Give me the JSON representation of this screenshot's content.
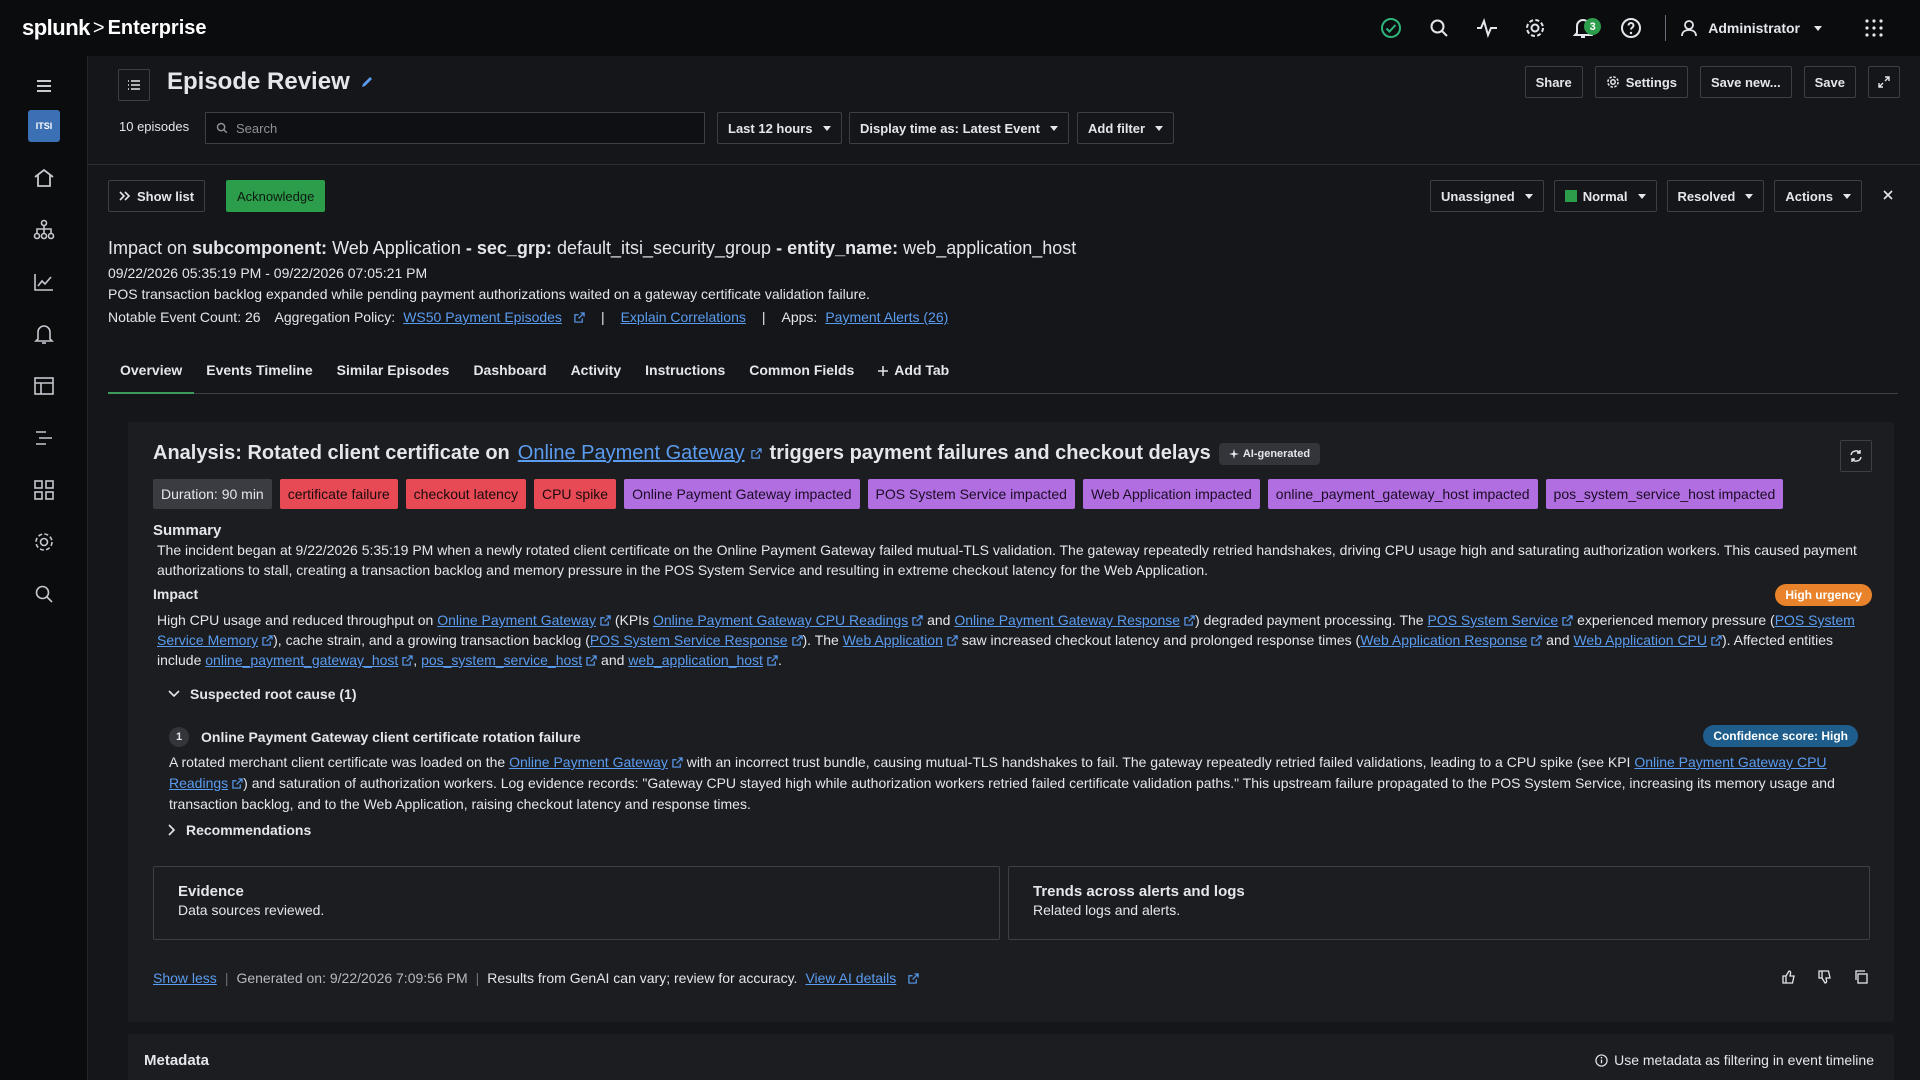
{
  "brand": {
    "name": "splunk",
    "sep": ">",
    "product": "Enterprise"
  },
  "topbar": {
    "notif_count": "3",
    "user": "Administrator"
  },
  "sidebar": {
    "app_badge": "ITSI"
  },
  "header": {
    "title": "Episode Review",
    "buttons": {
      "share": "Share",
      "settings": "Settings",
      "save_new": "Save new...",
      "save": "Save"
    },
    "episode_count": "10 episodes",
    "search_placeholder": "Search",
    "time_range": "Last 12 hours",
    "display_time": "Display time as: Latest Event",
    "add_filter": "Add filter"
  },
  "episode": {
    "show_list": "Show list",
    "acknowledge": "Acknowledge",
    "owner": "Unassigned",
    "severity": "Normal",
    "severity_color": "#2c9d4a",
    "status": "Resolved",
    "actions": "Actions",
    "title_prefix": "Impact on",
    "k1": "subcomponent:",
    "v1": "Web Application",
    "dash": "-",
    "k2": "sec_grp:",
    "v2": "default_itsi_security_group",
    "k3": "entity_name:",
    "v3": "web_application_host",
    "time_range": "09/22/2026 05:35:19 PM - 09/22/2026 07:05:21 PM",
    "description": "POS transaction backlog expanded while pending payment authorizations waited on a gateway certificate validation failure.",
    "notable_count": "Notable Event Count: 26",
    "agg_label": "Aggregation Policy:",
    "agg_link": "WS50 Payment Episodes",
    "pipe": "|",
    "explain": "Explain Correlations",
    "apps_label": "Apps:",
    "apps_link": "Payment Alerts (26)"
  },
  "tabs": [
    "Overview",
    "Events Timeline",
    "Similar Episodes",
    "Dashboard",
    "Activity",
    "Instructions",
    "Common Fields",
    "Add Tab"
  ],
  "analysis": {
    "title_pre": "Analysis: Rotated client certificate on",
    "title_link": "Online Payment Gateway",
    "title_post": "triggers payment failures and checkout delays",
    "ai_badge": "AI-generated",
    "duration": "Duration: 90 min",
    "red_tags": [
      "certificate failure",
      "checkout latency",
      "CPU spike"
    ],
    "purple_tags": [
      "Online Payment Gateway impacted",
      "POS System Service impacted",
      "Web Application impacted",
      "online_payment_gateway_host impacted",
      "pos_system_service_host impacted"
    ],
    "summary_h": "Summary",
    "summary": "The incident began at 9/22/2026 5:35:19 PM when a newly rotated client certificate on the Online Payment Gateway failed mutual-TLS validation. The gateway repeatedly retried handshakes, driving CPU usage high and saturating authorization workers. This caused payment authorizations to stall, creating a transaction backlog and memory pressure in the POS System Service and resulting in extreme checkout latency for the Web Application.",
    "impact_h": "Impact",
    "urgency": "High urgency",
    "impact": {
      "t1": "High CPU usage and reduced throughput on",
      "l1": "Online Payment Gateway",
      "t2": "(KPIs",
      "l2": "Online Payment Gateway CPU Readings",
      "t3": "and",
      "l3": "Online Payment Gateway Response",
      "t4": ") degraded payment processing. The",
      "l4": "POS System Service",
      "t5": "experienced memory pressure (",
      "l5": "POS System Service Memory",
      "t6": "), cache strain, and a growing transaction backlog (",
      "l6": "POS System Service Response",
      "t7": "). The",
      "l7": "Web Application",
      "t8": "saw increased checkout latency and prolonged response times (",
      "l8": "Web Application Response",
      "t9": "and",
      "l9": "Web Application CPU",
      "t10": "). Affected entities include",
      "l10": "online_payment_gateway_host",
      "t11": ",",
      "l11": "pos_system_service_host",
      "t12": "and",
      "l12": "web_application_host",
      "t13": "."
    },
    "root_cause_h": "Suspected root cause (1)",
    "rc_num": "1",
    "rc_title": "Online Payment Gateway client certificate rotation failure",
    "confidence": "Confidence score: High",
    "rc": {
      "t1": "A rotated merchant client certificate was loaded on the",
      "l1": "Online Payment Gateway",
      "t2": "with an incorrect trust bundle, causing mutual-TLS handshakes to fail. The gateway repeatedly retried failed validations, leading to a CPU spike (see KPI",
      "l2": "Online Payment Gateway CPU Readings",
      "t3": ") and saturation of authorization workers. Log evidence records: \"Gateway CPU stayed high while authorization workers retried failed certificate validation paths.\" This upstream failure propagated to the POS System Service, increasing its memory usage and transaction backlog, and to the Web Application, raising checkout latency and response times."
    },
    "recommendations": "Recommendations",
    "evidence_h": "Evidence",
    "evidence_sub": "Data sources reviewed.",
    "trends_h": "Trends across alerts and logs",
    "trends_sub": "Related logs and alerts.",
    "show_less": "Show less",
    "generated": "Generated on: 9/22/2026 7:09:56 PM",
    "disclaimer": "Results from GenAI can vary; review for accuracy.",
    "view_ai": "View AI details"
  },
  "metadata": {
    "title": "Metadata",
    "hint": "Use metadata as filtering in event timeline"
  }
}
